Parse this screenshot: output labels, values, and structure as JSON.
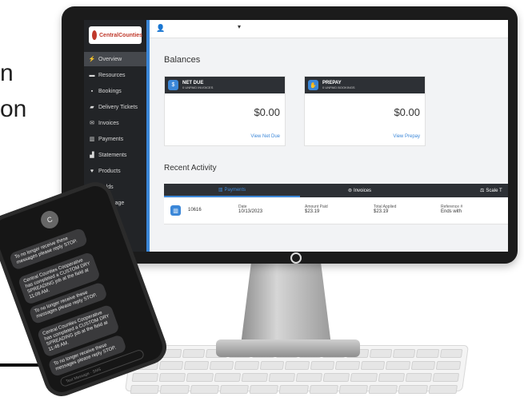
{
  "background": {
    "text_line_1": "n",
    "text_line_2": "on"
  },
  "app": {
    "logo_text": "CentralCounties",
    "topbar": {
      "user_icon": "user-icon",
      "caret": "▾"
    },
    "sidebar": {
      "items": [
        {
          "label": "Overview",
          "icon": "bolt-icon",
          "active": true
        },
        {
          "label": "Resources",
          "icon": "folder-icon"
        },
        {
          "label": "Bookings",
          "icon": "message-icon"
        },
        {
          "label": "Delivery Tickets",
          "icon": "truck-icon"
        },
        {
          "label": "Invoices",
          "icon": "envelope-icon"
        },
        {
          "label": "Payments",
          "icon": "money-icon"
        },
        {
          "label": "Statements",
          "icon": "chart-icon"
        },
        {
          "label": "Products",
          "icon": "droplet-icon"
        },
        {
          "label": "Fields",
          "icon": "field-icon"
        },
        {
          "label": "Patronage",
          "icon": "patronage-icon"
        }
      ]
    },
    "balances_heading": "Balances",
    "net_due": {
      "title": "NET DUE",
      "subtitle": "0 UNPAID INVOICES",
      "amount": "$0.00",
      "link": "View Net Due"
    },
    "prepay": {
      "title": "PREPAY",
      "subtitle": "0 UNPAID BOOKINGS",
      "amount": "$0.00",
      "link": "View Prepay"
    },
    "recent_activity_heading": "Recent Activity",
    "activity_tabs": [
      {
        "label": "Payments",
        "active": true
      },
      {
        "label": "Invoices"
      },
      {
        "label": "Scale T"
      }
    ],
    "activity_row": {
      "number": "10616",
      "date_label": "Date",
      "date_value": "10/13/2023",
      "amount_paid_label": "Amount Paid",
      "amount_paid_value": "$23.19",
      "total_applied_label": "Total Applied",
      "total_applied_value": "$23.19",
      "reference_label": "Reference #",
      "reference_value": "Ends with"
    },
    "accent_color": "#3b87d8"
  },
  "phone": {
    "contact_initial": "C",
    "messages": [
      "To no longer receive these messages please reply STOP.",
      "Central Counties Cooperative has completed a CUSTOM DRY SPREADING job at the field at 11:08 AM.",
      "To no longer receive these messages please reply STOP.",
      "Central Counties Cooperative has completed a CUSTOM DRY SPREADING job at the field at 11:48 AM.",
      "To no longer receive these messages please reply STOP."
    ],
    "composer_placeholder": "Text Message · SMS"
  }
}
